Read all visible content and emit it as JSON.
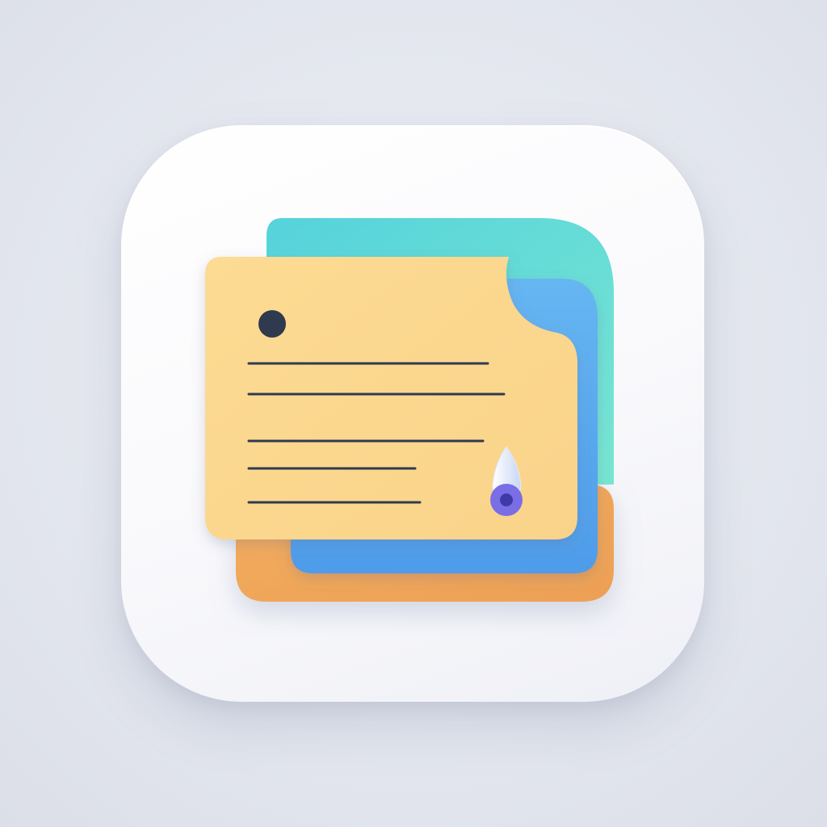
{
  "icon": {
    "name": "document-stack-app-icon",
    "colors": {
      "background": "#e3e6ee",
      "tile": "#ffffff",
      "back_sheet_teal": "#5fd8d6",
      "middle_sheet_blue": "#5ba8ee",
      "bottom_sheet_orange": "#f0a95a",
      "front_sheet_yellow": "#fbd98e",
      "text_lines": "#2f3a4f",
      "dot": "#2f3a4f",
      "pen_nib": "#7a6ee6"
    },
    "glyphs": [
      "document-icon",
      "text-lines",
      "pen-nib-icon"
    ]
  }
}
